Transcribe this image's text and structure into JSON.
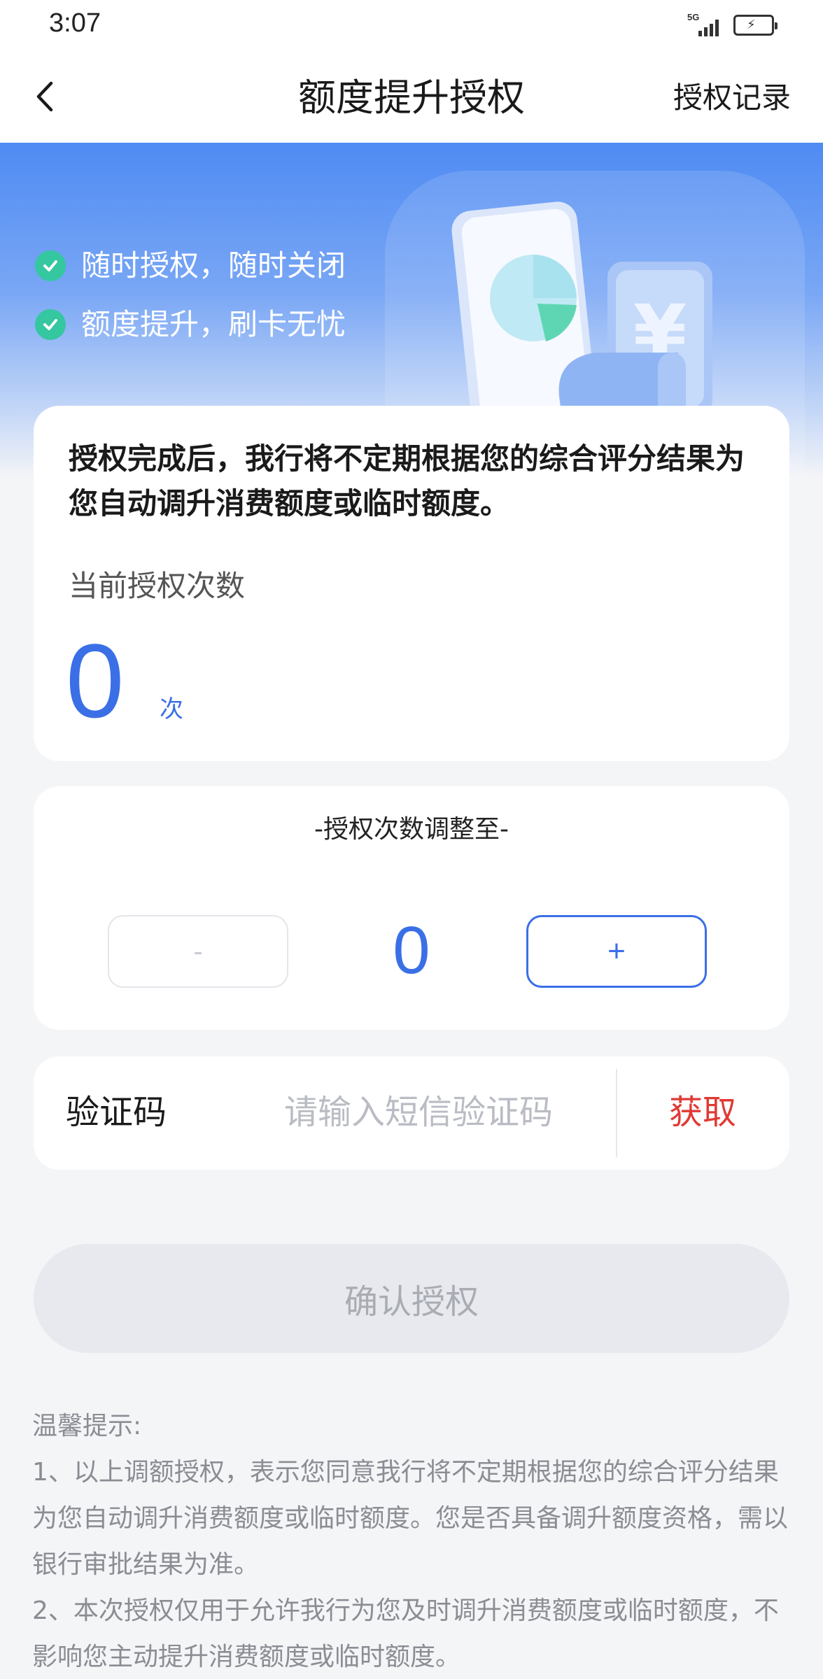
{
  "status_bar": {
    "time": "3:07",
    "network": "5G"
  },
  "nav": {
    "title": "额度提升授权",
    "right_link": "授权记录"
  },
  "hero": {
    "items": [
      "随时授权，随时关闭",
      "额度提升，刷卡无忧"
    ]
  },
  "info": {
    "description": "授权完成后，我行将不定期根据您的综合评分结果为您自动调升消费额度或临时额度。",
    "count_label": "当前授权次数",
    "count_value": "0",
    "count_unit": "次"
  },
  "adjust": {
    "title": "-授权次数调整至-",
    "minus_label": "-",
    "value": "0",
    "plus_label": "+"
  },
  "verify": {
    "label": "验证码",
    "placeholder": "请输入短信验证码",
    "get_label": "获取"
  },
  "confirm_label": "确认授权",
  "tips": {
    "title": "温馨提示:",
    "lines": [
      "1、以上调额授权，表示您同意我行将不定期根据您的综合评分结果为您自动调升消费额度或临时额度。您是否具备调升额度资格，需以银行审批结果为准。",
      "2、本次授权仅用于允许我行为您及时调升消费额度或临时额度，不影响您主动提升消费额度或临时额度。"
    ]
  },
  "colors": {
    "accent": "#3b6fe6",
    "hero_top": "#4f8bf3",
    "check": "#34c7a0",
    "danger": "#e03a34",
    "disabled_bg": "#e7e9ee"
  }
}
